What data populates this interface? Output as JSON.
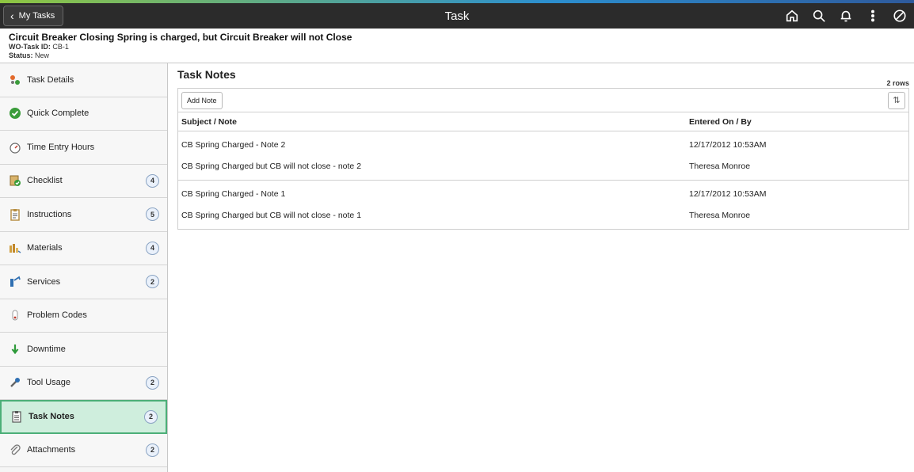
{
  "banner": {
    "back_label": "My Tasks",
    "title": "Task"
  },
  "header": {
    "title": "Circuit Breaker Closing Spring is charged, but Circuit Breaker will not Close",
    "task_id_label": "WO-Task ID:",
    "task_id_value": "CB-1",
    "status_label": "Status:",
    "status_value": "New"
  },
  "sidebar": {
    "items": [
      {
        "label": "Task Details",
        "icon": "task-details-icon",
        "badge": ""
      },
      {
        "label": "Quick Complete",
        "icon": "check-circle-icon",
        "badge": ""
      },
      {
        "label": "Time Entry Hours",
        "icon": "stopwatch-icon",
        "badge": ""
      },
      {
        "label": "Checklist",
        "icon": "checklist-icon",
        "badge": "4"
      },
      {
        "label": "Instructions",
        "icon": "clipboard-icon",
        "badge": "5"
      },
      {
        "label": "Materials",
        "icon": "materials-icon",
        "badge": "4"
      },
      {
        "label": "Services",
        "icon": "services-icon",
        "badge": "2"
      },
      {
        "label": "Problem Codes",
        "icon": "problem-codes-icon",
        "badge": ""
      },
      {
        "label": "Downtime",
        "icon": "down-arrow-icon",
        "badge": ""
      },
      {
        "label": "Tool Usage",
        "icon": "tool-icon",
        "badge": "2"
      },
      {
        "label": "Task Notes",
        "icon": "notes-icon",
        "badge": "2"
      },
      {
        "label": "Attachments",
        "icon": "paperclip-icon",
        "badge": "2"
      }
    ]
  },
  "main": {
    "heading": "Task Notes",
    "rows_count": "2 rows",
    "add_note_label": "Add Note",
    "columns": [
      "Subject / Note",
      "Entered On / By"
    ],
    "rows": [
      {
        "subject": "CB Spring Charged - Note 2",
        "entered_on": "12/17/2012 10:53AM",
        "note": "CB Spring Charged but CB will not close - note 2",
        "entered_by": "Theresa Monroe"
      },
      {
        "subject": "CB Spring Charged - Note 1",
        "entered_on": "12/17/2012 10:53AM",
        "note": "CB Spring Charged but CB will not close - note 1",
        "entered_by": "Theresa Monroe"
      }
    ]
  },
  "colors": {
    "banner": "#2b2b2b",
    "active_nav": "#cfeedd",
    "active_border": "#4caf78"
  }
}
